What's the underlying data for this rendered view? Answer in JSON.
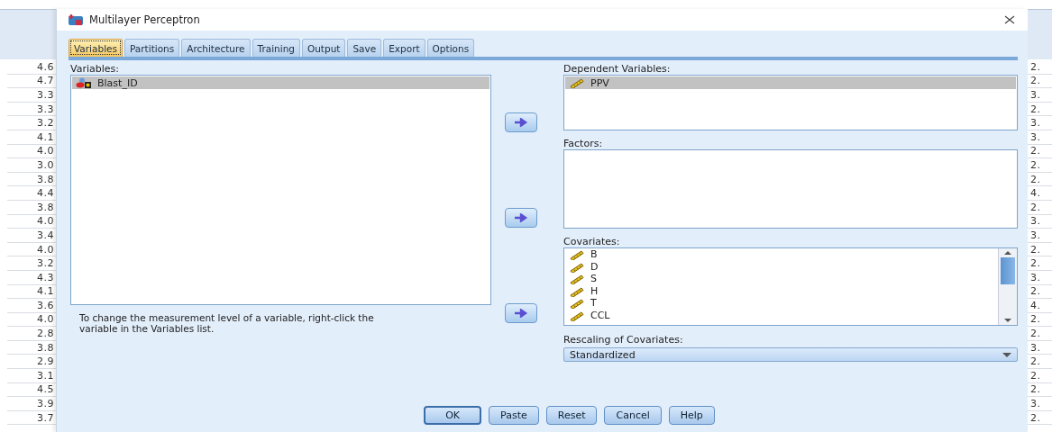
{
  "background_sheet": {
    "left_column": [
      "4.6",
      "4.7",
      "3.3",
      "3.3",
      "3.2",
      "4.1",
      "4.0",
      "3.0",
      "3.8",
      "4.4",
      "3.8",
      "4.0",
      "3.4",
      "4.0",
      "3.2",
      "4.3",
      "4.1",
      "3.6",
      "4.0",
      "2.8",
      "3.8",
      "2.9",
      "3.1",
      "4.5",
      "3.9",
      "3.7"
    ],
    "right_column": [
      "2.",
      "2.",
      "3.",
      "2.",
      "3.",
      "3.",
      "2.",
      "2.",
      "2.",
      "4.",
      "2.",
      "3.",
      "3.",
      "2.",
      "2.",
      "3.",
      "2.",
      "4.",
      "2.",
      "2.",
      "3.",
      "2.",
      "2.",
      "2.",
      "3.",
      "2."
    ]
  },
  "window": {
    "title": "Multilayer Perceptron"
  },
  "tabs": [
    {
      "label": "Variables",
      "selected": true
    },
    {
      "label": "Partitions",
      "selected": false
    },
    {
      "label": "Architecture",
      "selected": false
    },
    {
      "label": "Training",
      "selected": false
    },
    {
      "label": "Output",
      "selected": false
    },
    {
      "label": "Save",
      "selected": false
    },
    {
      "label": "Export",
      "selected": false
    },
    {
      "label": "Options",
      "selected": false
    }
  ],
  "variables": {
    "label": "Variables:",
    "items": [
      {
        "name": "Blast_ID",
        "kind": "nominal",
        "selected": true
      }
    ],
    "hint": "To change the measurement level of a variable, right-click the variable in the Variables list."
  },
  "dependent_variables": {
    "label": "Dependent Variables:",
    "items": [
      {
        "name": "PPV",
        "kind": "scale",
        "selected": true
      }
    ]
  },
  "factors": {
    "label": "Factors:"
  },
  "covariates": {
    "label": "Covariates:",
    "items": [
      {
        "name": "B",
        "kind": "scale",
        "selected": false
      },
      {
        "name": "D",
        "kind": "scale",
        "selected": false
      },
      {
        "name": "S",
        "kind": "scale",
        "selected": false
      },
      {
        "name": "H",
        "kind": "scale",
        "selected": false
      },
      {
        "name": "T",
        "kind": "scale",
        "selected": false
      },
      {
        "name": "CCL",
        "kind": "scale",
        "selected": false
      }
    ]
  },
  "rescaling": {
    "label": "Rescaling of Covariates:",
    "value": "Standardized"
  },
  "buttons": [
    "OK",
    "Paste",
    "Reset",
    "Cancel",
    "Help"
  ]
}
